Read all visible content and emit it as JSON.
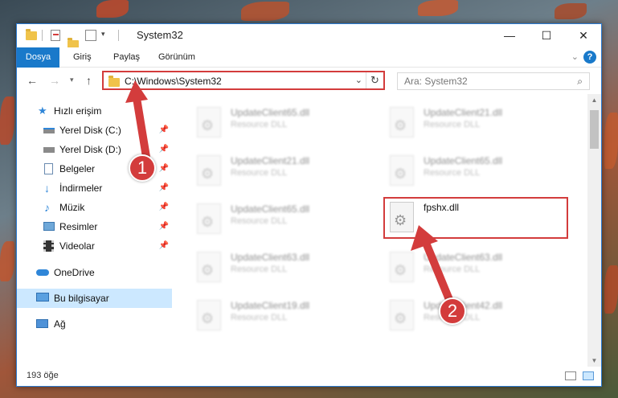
{
  "window": {
    "title": "System32",
    "minimize": "—",
    "maximize": "☐",
    "close": "✕"
  },
  "ribbon": {
    "tabs": [
      "Dosya",
      "Giriş",
      "Paylaş",
      "Görünüm"
    ],
    "help": "?"
  },
  "nav": {
    "address": "C:\\Windows\\System32",
    "search_placeholder": "Ara: System32"
  },
  "sidebar": {
    "quick_access": "Hızlı erişim",
    "items": [
      {
        "label": "Yerel Disk (C:)",
        "icon": "drive-icon"
      },
      {
        "label": "Yerel Disk (D:)",
        "icon": "drive-icon"
      },
      {
        "label": "Belgeler",
        "icon": "documents-icon"
      },
      {
        "label": "İndirmeler",
        "icon": "download-icon"
      },
      {
        "label": "Müzik",
        "icon": "music-icon"
      },
      {
        "label": "Resimler",
        "icon": "pictures-icon"
      },
      {
        "label": "Videolar",
        "icon": "videos-icon"
      }
    ],
    "onedrive": "OneDrive",
    "this_pc": "Bu bilgisayar",
    "network": "Ağ"
  },
  "files": [
    {
      "name": "UpdateClient65.dll",
      "type": "Resource DLL"
    },
    {
      "name": "UpdateClient21.dll",
      "type": "Resource DLL"
    },
    {
      "name": "UpdateClient21.dll",
      "type": "Resource DLL"
    },
    {
      "name": "UpdateClient65.dll",
      "type": "Resource DLL"
    },
    {
      "name": "UpdateClient65.dll",
      "type": "Resource DLL"
    },
    {
      "name": "fpshx.dll",
      "type": ""
    },
    {
      "name": "UpdateClient63.dll",
      "type": "Resource DLL"
    },
    {
      "name": "UpdateClient63.dll",
      "type": "Resource DLL"
    },
    {
      "name": "UpdateClient19.dll",
      "type": "Resource DLL"
    },
    {
      "name": "UpdateClient42.dll",
      "type": "Resource DLL"
    }
  ],
  "status": {
    "count": "193 öğe"
  },
  "annotations": {
    "step1": "1",
    "step2": "2"
  },
  "colors": {
    "accent": "#1979ca",
    "highlight": "#d33c3c",
    "selected": "#cce8ff"
  }
}
